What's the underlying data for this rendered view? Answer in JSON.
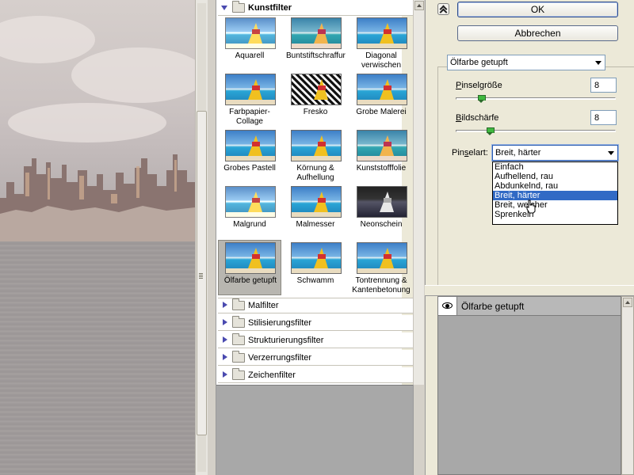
{
  "buttons": {
    "ok": "OK",
    "cancel": "Abbrechen"
  },
  "gallery": {
    "open_category": "Kunstfilter",
    "filters": [
      {
        "label": "Aquarell"
      },
      {
        "label": "Buntstiftschraffur"
      },
      {
        "label": "Diagonal verwischen"
      },
      {
        "label": "Farbpapier-Collage"
      },
      {
        "label": "Fresko"
      },
      {
        "label": "Grobe Malerei"
      },
      {
        "label": "Grobes Pastell"
      },
      {
        "label": "Körnung & Aufhellung"
      },
      {
        "label": "Kunststofffolie"
      },
      {
        "label": "Malgrund"
      },
      {
        "label": "Malmesser"
      },
      {
        "label": "Neonschein"
      },
      {
        "label": "Ölfarbe getupft"
      },
      {
        "label": "Schwamm"
      },
      {
        "label": "Tontrennung & Kantenbetonung"
      }
    ],
    "categories": [
      "Malfilter",
      "Stilisierungsfilter",
      "Strukturierungsfilter",
      "Verzerrungsfilter",
      "Zeichenfilter"
    ]
  },
  "options": {
    "filter_select": "Ölfarbe getupft",
    "brush_size": {
      "label_u": "P",
      "label_rest": "inselgröße",
      "value": "8",
      "fraction": 0.2
    },
    "sharpness": {
      "label_u": "B",
      "label_rest": "ildschärfe",
      "value": "8",
      "fraction": 0.2
    },
    "brush_type": {
      "label_pre": "Pin",
      "label_u": "s",
      "label_post": "elart:",
      "value": "Breit, härter"
    },
    "brush_type_options": [
      "Einfach",
      "Aufhellend, rau",
      "Abdunkelnd, rau",
      "Breit, härter",
      "Breit, weicher",
      "Sprenkeln"
    ],
    "highlighted_option": "Breit, härter"
  },
  "layers": {
    "effect_name": "Ölfarbe getupft"
  }
}
